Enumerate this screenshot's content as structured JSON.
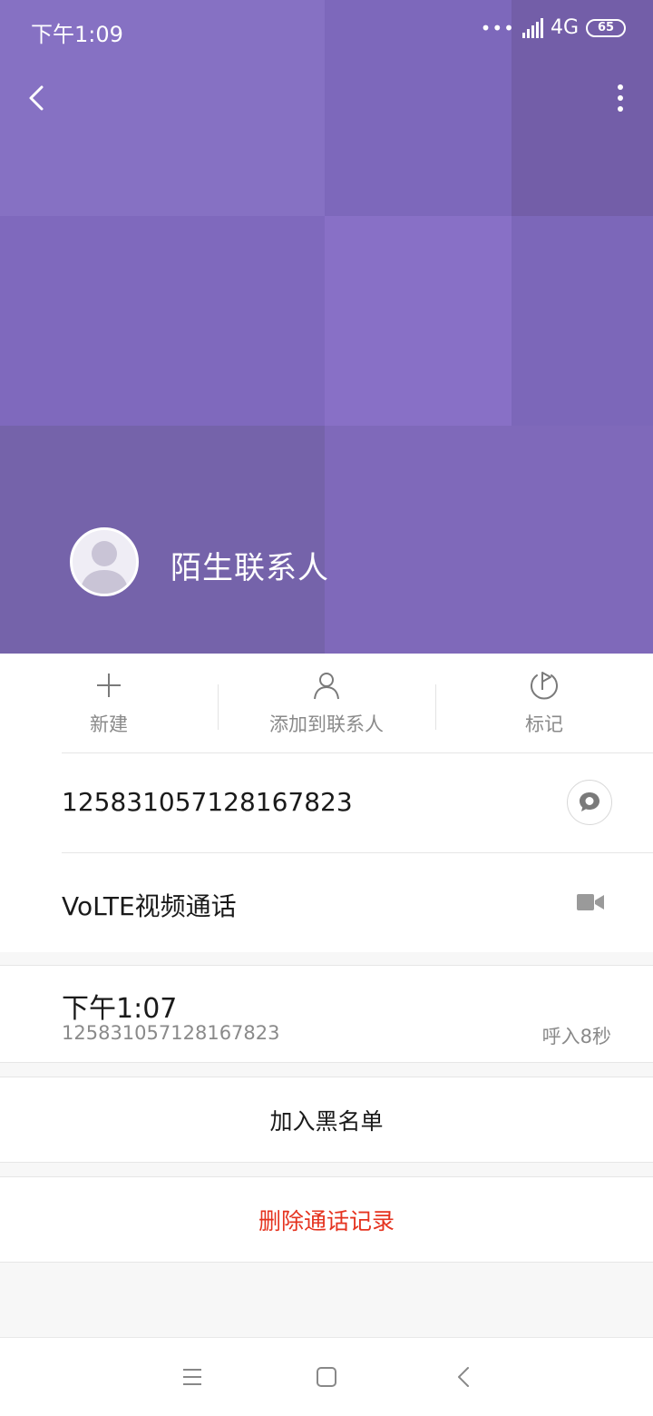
{
  "status_bar": {
    "time": "下午1:09",
    "dots": "•••",
    "network": "4G",
    "battery": "65"
  },
  "header": {
    "contact_name": "陌生联系人"
  },
  "actions": [
    {
      "label": "新建",
      "icon": "plus-icon"
    },
    {
      "label": "添加到联系人",
      "icon": "person-icon"
    },
    {
      "label": "标记",
      "icon": "flag-icon"
    }
  ],
  "phone": {
    "number": "125831057128167823",
    "message_icon": "message-icon"
  },
  "video_call": {
    "label": "VoLTE视频通话",
    "icon": "video-camera-icon"
  },
  "call_log": {
    "time": "下午1:07",
    "number": "125831057128167823",
    "duration": "呼入8秒"
  },
  "buttons": {
    "block": "加入黑名单",
    "delete": "删除通话记录"
  },
  "colors": {
    "header_purple": "#7f69bd",
    "delete_red": "#e5331f"
  }
}
